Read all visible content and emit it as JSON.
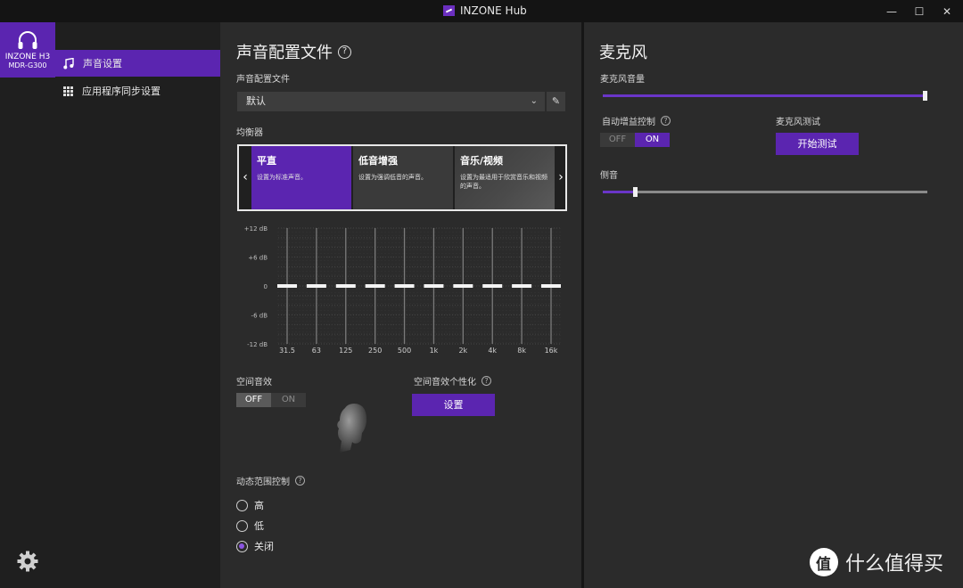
{
  "window": {
    "title": "INZONE Hub",
    "controls": {
      "minimize": "—",
      "maximize": "☐",
      "close": "✕"
    }
  },
  "sidebar": {
    "device": {
      "name": "INZONE H3",
      "model": "MDR-G300",
      "icon": "headphones-icon"
    },
    "items": [
      {
        "label": "声音设置",
        "icon": "music-note-icon",
        "active": true
      },
      {
        "label": "应用程序同步设置",
        "icon": "grid-icon",
        "active": false
      }
    ],
    "settings_icon": "gear-icon"
  },
  "sound": {
    "title": "声音配置文件",
    "profile_label": "声音配置文件",
    "profile_value": "默认",
    "equalizer_label": "均衡器",
    "presets": [
      {
        "title": "平直",
        "desc": "设置为标准声音。",
        "active": true
      },
      {
        "title": "低音增强",
        "desc": "设置为强调低音的声音。",
        "active": false
      },
      {
        "title": "音乐/视频",
        "desc": "设置为最适用于欣赏音乐和视频的声音。",
        "active": false
      }
    ],
    "eq": {
      "y_labels": [
        "+12 dB",
        "+6 dB",
        "0",
        "-6 dB",
        "-12 dB"
      ],
      "bands": [
        "31.5",
        "63",
        "125",
        "250",
        "500",
        "1k",
        "2k",
        "4k",
        "8k",
        "16k"
      ],
      "gains_db": [
        0,
        0,
        0,
        0,
        0,
        0,
        0,
        0,
        0,
        0
      ]
    },
    "spatial": {
      "label": "空间音效",
      "toggle_off": "OFF",
      "toggle_on": "ON",
      "state": "OFF",
      "personalize_label": "空间音效个性化",
      "setup_button": "设置"
    },
    "drc": {
      "label": "动态范围控制",
      "options": [
        "高",
        "低",
        "关闭"
      ],
      "selected": "关闭"
    }
  },
  "mic": {
    "title": "麦克风",
    "volume_label": "麦克风音量",
    "volume_level": 1.0,
    "agc_label": "自动增益控制",
    "agc_off": "OFF",
    "agc_on": "ON",
    "agc_state": "ON",
    "test_label": "麦克风测试",
    "test_button": "开始测试",
    "sidetone_label": "侧音",
    "sidetone_level": 0.1
  },
  "watermark": {
    "text": "什么值得买"
  },
  "colors": {
    "accent": "#5b25b0",
    "panel": "#2b2b2b",
    "sidebar": "#1f1f1f"
  }
}
